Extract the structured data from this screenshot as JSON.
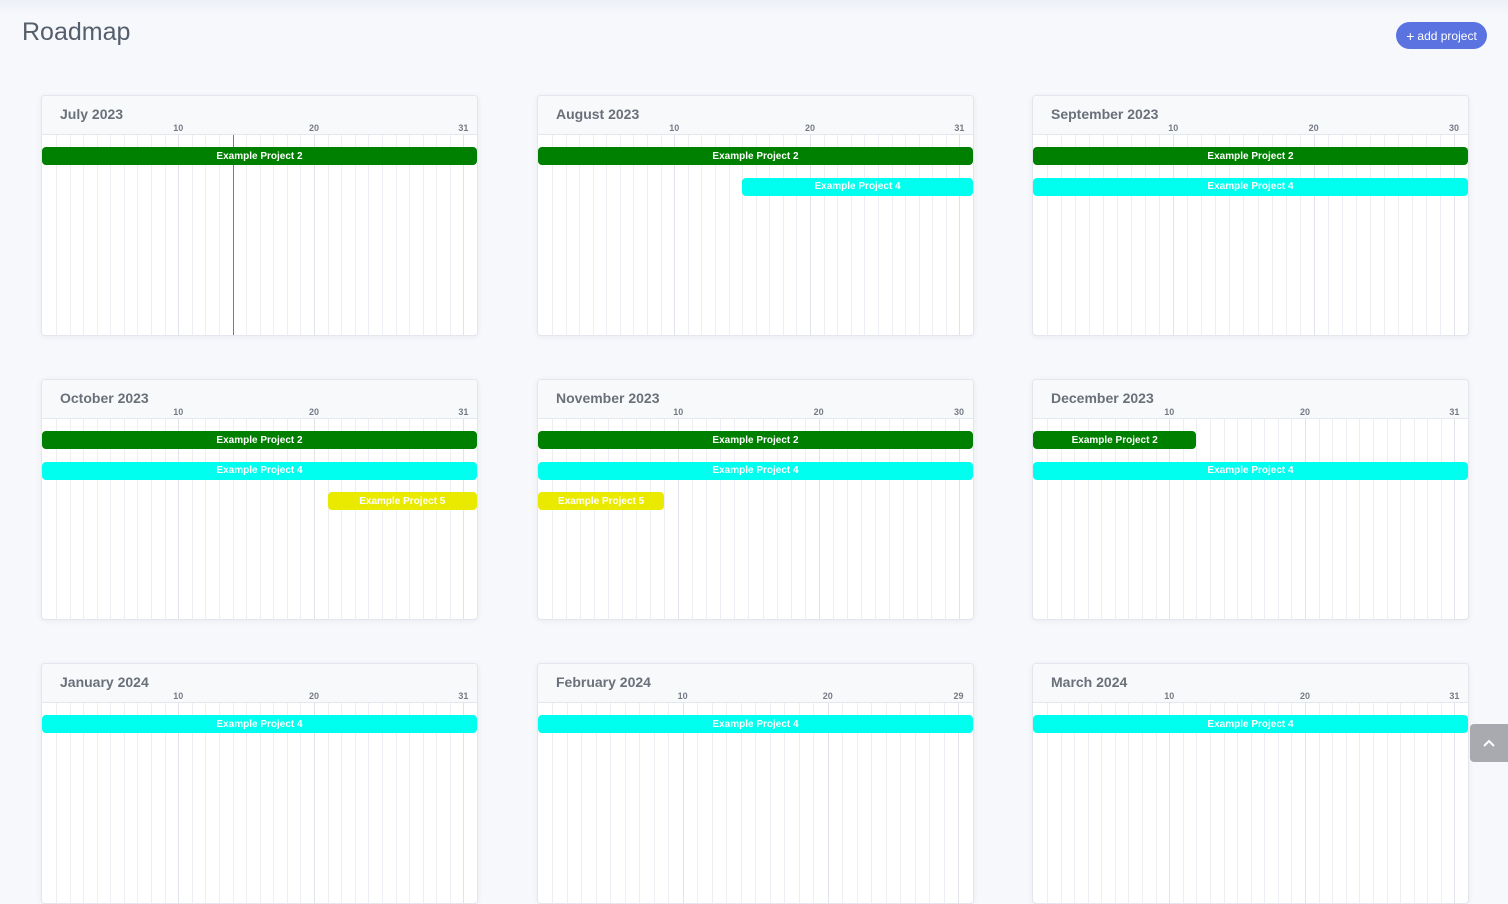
{
  "header": {
    "title": "Roadmap",
    "add_button": {
      "icon": "plus-icon",
      "label": "add project"
    }
  },
  "colors": {
    "today_line": "#e05050",
    "accent": "#5a73e0"
  },
  "today": "2023-07-14",
  "months": [
    {
      "title": "July 2023",
      "days": 31,
      "ticks": [
        "10",
        "20",
        "31"
      ],
      "today_day": 14,
      "bars": [
        {
          "label": "Example Project 2",
          "start": 1,
          "end": 31,
          "color": "#008000",
          "text_color": "#ffffff"
        }
      ]
    },
    {
      "title": "August 2023",
      "days": 31,
      "ticks": [
        "10",
        "20",
        "31"
      ],
      "bars": [
        {
          "label": "Example Project 2",
          "start": 1,
          "end": 31,
          "color": "#008000",
          "text_color": "#ffffff"
        },
        {
          "label": "Example Project 4",
          "start": 15,
          "end": 31,
          "color": "#00ffee",
          "text_color": "#ffffff"
        }
      ]
    },
    {
      "title": "September 2023",
      "days": 30,
      "ticks": [
        "10",
        "20",
        "30"
      ],
      "bars": [
        {
          "label": "Example Project 2",
          "start": 1,
          "end": 30,
          "color": "#008000",
          "text_color": "#ffffff"
        },
        {
          "label": "Example Project 4",
          "start": 1,
          "end": 30,
          "color": "#00ffee",
          "text_color": "#ffffff"
        }
      ]
    },
    {
      "title": "October 2023",
      "days": 31,
      "ticks": [
        "10",
        "20",
        "31"
      ],
      "bars": [
        {
          "label": "Example Project 2",
          "start": 1,
          "end": 31,
          "color": "#008000",
          "text_color": "#ffffff"
        },
        {
          "label": "Example Project 4",
          "start": 1,
          "end": 31,
          "color": "#00ffee",
          "text_color": "#ffffff"
        },
        {
          "label": "Example Project 5",
          "start": 21,
          "end": 31,
          "color": "#eaea00",
          "text_color": "#ffffff"
        }
      ]
    },
    {
      "title": "November 2023",
      "days": 30,
      "ticks": [
        "10",
        "20",
        "30"
      ],
      "bars": [
        {
          "label": "Example Project 2",
          "start": 1,
          "end": 30,
          "color": "#008000",
          "text_color": "#ffffff"
        },
        {
          "label": "Example Project 4",
          "start": 1,
          "end": 30,
          "color": "#00ffee",
          "text_color": "#ffffff"
        },
        {
          "label": "Example Project 5",
          "start": 1,
          "end": 8,
          "color": "#eaea00",
          "text_color": "#ffffff"
        }
      ]
    },
    {
      "title": "December 2023",
      "days": 31,
      "ticks": [
        "10",
        "20",
        "31"
      ],
      "bars": [
        {
          "label": "Example Project 2",
          "start": 1,
          "end": 11,
          "color": "#008000",
          "text_color": "#ffffff"
        },
        {
          "label": "Example Project 4",
          "start": 1,
          "end": 31,
          "color": "#00ffee",
          "text_color": "#ffffff"
        }
      ]
    },
    {
      "title": "January 2024",
      "days": 31,
      "ticks": [
        "10",
        "20",
        "31"
      ],
      "bars": [
        {
          "label": "Example Project 4",
          "start": 1,
          "end": 31,
          "color": "#00ffee",
          "text_color": "#ffffff"
        }
      ]
    },
    {
      "title": "February 2024",
      "days": 29,
      "ticks": [
        "10",
        "20",
        "29"
      ],
      "bars": [
        {
          "label": "Example Project 4",
          "start": 1,
          "end": 29,
          "color": "#00ffee",
          "text_color": "#ffffff"
        }
      ]
    },
    {
      "title": "March 2024",
      "days": 31,
      "ticks": [
        "10",
        "20",
        "31"
      ],
      "bars": [
        {
          "label": "Example Project 4",
          "start": 1,
          "end": 31,
          "color": "#00ffee",
          "text_color": "#ffffff"
        }
      ]
    }
  ],
  "scroll_top_button": {
    "icon": "chevron-up-icon"
  }
}
